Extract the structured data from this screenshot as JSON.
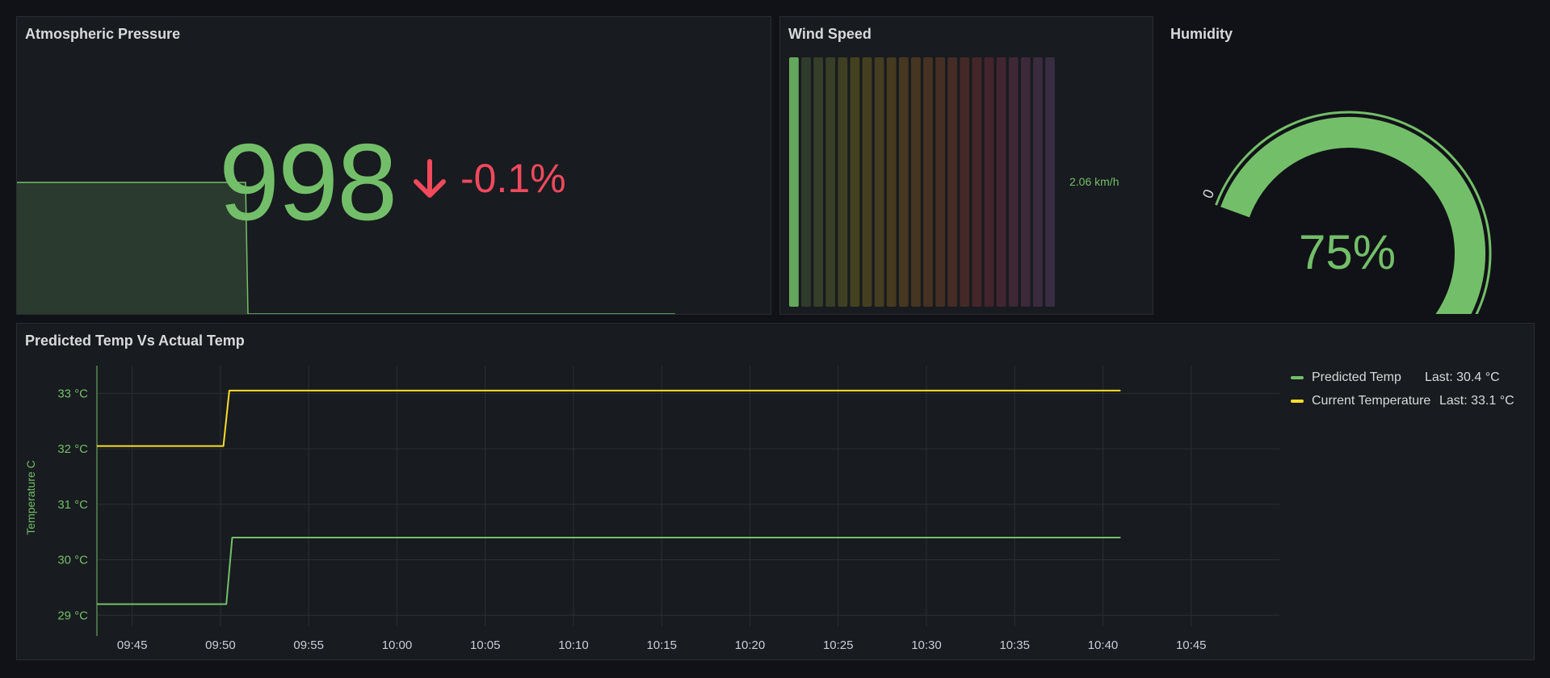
{
  "pressure": {
    "title": "Atmospheric Pressure",
    "value": "998",
    "change": "-0.1%",
    "colors": {
      "value": "#73bf69",
      "change": "#f2495c"
    }
  },
  "wind": {
    "title": "Wind Speed",
    "value_label": "2.06 km/h",
    "level": 0.04,
    "segments": 22
  },
  "humidity": {
    "title": "Humidity",
    "value": "75%",
    "fraction": 0.75,
    "min": "0",
    "max": "100"
  },
  "temp": {
    "title": "Predicted Temp Vs Actual Temp",
    "legend": [
      {
        "name": "Predicted Temp",
        "last": "Last: 30.4 °C",
        "color": "#73bf69"
      },
      {
        "name": "Current Temperature",
        "last": "Last: 33.1 °C",
        "color": "#fade2a"
      }
    ]
  },
  "chart_data": {
    "type": "line",
    "title": "Predicted Temp Vs Actual Temp",
    "ylabel": "Temperature C",
    "xlabel": "",
    "x_ticks": [
      "09:45",
      "09:50",
      "09:55",
      "10:00",
      "10:05",
      "10:10",
      "10:15",
      "10:20",
      "10:25",
      "10:30",
      "10:35",
      "10:40",
      "10:45"
    ],
    "y_ticks": [
      "29 °C",
      "30 °C",
      "31 °C",
      "32 °C",
      "33 °C"
    ],
    "xlim": [
      "09:43",
      "10:50"
    ],
    "ylim": [
      28.8,
      33.5
    ],
    "grid": true,
    "legend_position": "top-right",
    "series": [
      {
        "name": "Predicted Temp",
        "color": "#73bf69",
        "points": [
          [
            "09:43",
            29.2
          ],
          [
            "09:50:20",
            29.2
          ],
          [
            "09:50:40",
            30.4
          ],
          [
            "10:41",
            30.4
          ]
        ]
      },
      {
        "name": "Current Temperature",
        "color": "#fade2a",
        "points": [
          [
            "09:43",
            32.05
          ],
          [
            "09:50:10",
            32.05
          ],
          [
            "09:50:30",
            33.05
          ],
          [
            "10:41",
            33.05
          ]
        ]
      }
    ]
  }
}
